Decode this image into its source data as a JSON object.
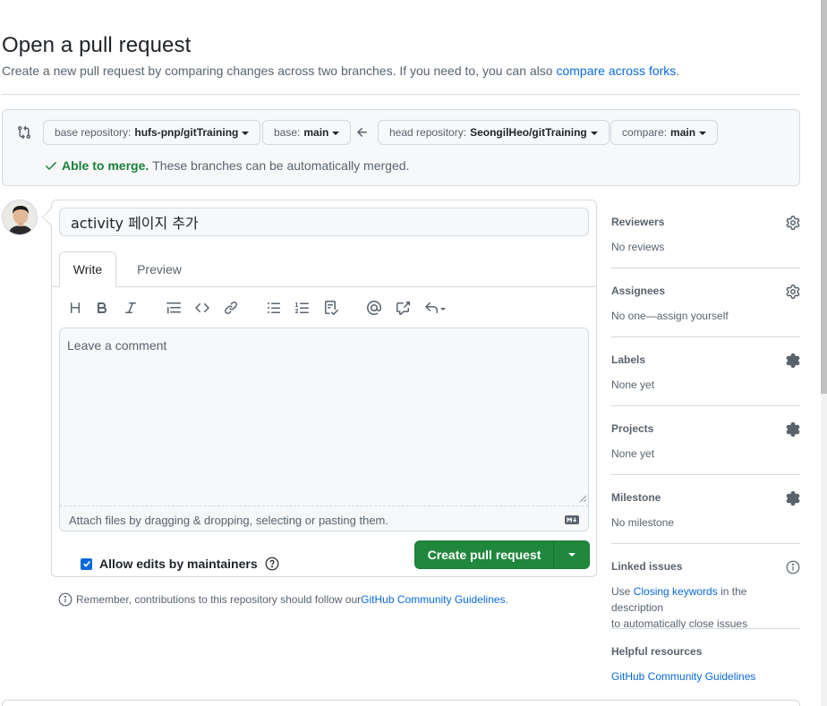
{
  "header": {
    "title": "Open a pull request",
    "subtitle": "Create a new pull request by comparing changes across two branches. If you need to, you can also ",
    "subtitle_link": "compare across forks",
    "subtitle_end": "."
  },
  "range": {
    "base_repo_label": "base repository:",
    "base_repo_value": "hufs-pnp/gitTraining",
    "base_label": "base:",
    "base_value": "main",
    "head_repo_label": "head repository:",
    "head_repo_value": "SeongilHeo/gitTraining",
    "compare_label": "compare:",
    "compare_value": "main",
    "merge_ok": "Able to merge.",
    "merge_text": "These branches can be automatically merged."
  },
  "form": {
    "title_value": "activity 페이지 추가",
    "tab_write": "Write",
    "tab_preview": "Preview",
    "comment_placeholder": "Leave a comment",
    "attach_text": "Attach files by dragging & dropping, selecting or pasting them.",
    "allow_edits": "Allow edits by maintainers",
    "create_label": "Create pull request"
  },
  "footer_note": {
    "text": "Remember, contributions to this repository should follow our ",
    "link": "GitHub Community Guidelines",
    "end": "."
  },
  "sidebar": {
    "reviewers_title": "Reviewers",
    "reviewers_value": "No reviews",
    "assignees_title": "Assignees",
    "assignees_value": "No one—assign yourself",
    "labels_title": "Labels",
    "labels_value": "None yet",
    "projects_title": "Projects",
    "projects_value": "None yet",
    "milestone_title": "Milestone",
    "milestone_value": "No milestone",
    "linked_title": "Linked issues",
    "linked_pre": "Use ",
    "linked_link": "Closing keywords",
    "linked_post": " in the description",
    "linked_line2": "to automatically close issues",
    "helpful_title": "Helpful resources",
    "helpful_link": "GitHub Community Guidelines"
  },
  "colors": {
    "accent": "#0969da",
    "success": "#1a7f37",
    "button_green": "#1f883d",
    "muted": "#59636e",
    "border": "#d1d9e0"
  }
}
